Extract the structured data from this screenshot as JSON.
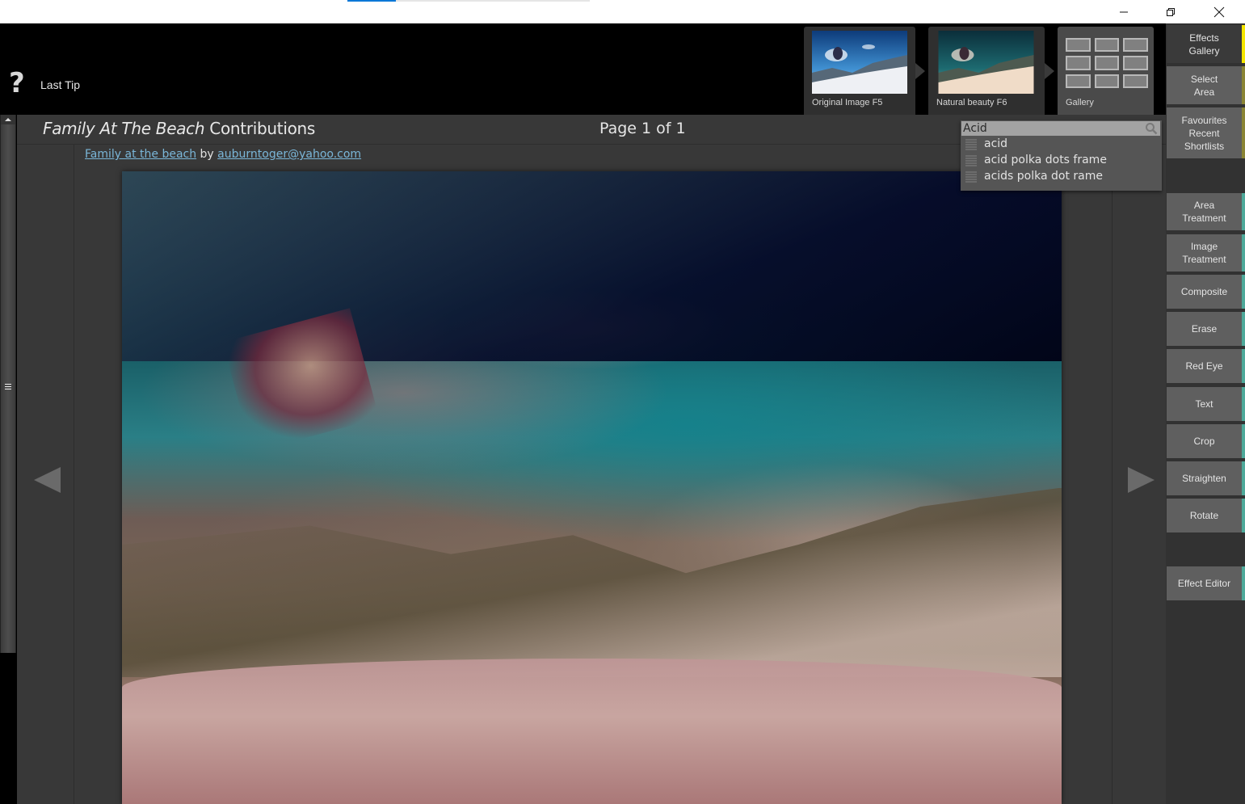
{
  "window": {
    "progress_fraction": 0.2,
    "controls": {
      "minimize": "minimize",
      "restore": "restore",
      "close": "close"
    }
  },
  "header": {
    "tip_icon": "?",
    "tip_label": "Last Tip",
    "thumbnails": [
      {
        "label": "Original Image F5"
      },
      {
        "label": "Natural beauty F6"
      },
      {
        "label": "Gallery"
      }
    ]
  },
  "sidebar": {
    "items": [
      {
        "lines": [
          "Effects",
          "Gallery"
        ]
      },
      {
        "lines": [
          "Select",
          "Area"
        ]
      },
      {
        "lines": [
          "Favourites",
          "Recent",
          "Shortlists"
        ]
      },
      {
        "lines": [
          "Area",
          "Treatment"
        ]
      },
      {
        "lines": [
          "Image",
          "Treatment"
        ]
      },
      {
        "lines": [
          "Composite"
        ]
      },
      {
        "lines": [
          "Erase"
        ]
      },
      {
        "lines": [
          "Red Eye"
        ]
      },
      {
        "lines": [
          "Text"
        ]
      },
      {
        "lines": [
          "Crop"
        ]
      },
      {
        "lines": [
          "Straighten"
        ]
      },
      {
        "lines": [
          "Rotate"
        ]
      },
      {
        "lines": [
          "Effect Editor"
        ]
      }
    ]
  },
  "main": {
    "title_italic": "Family At The Beach",
    "title_rest": " Contributions",
    "page_count": "Page 1 of 1",
    "byline": {
      "link_title": "Family at the beach",
      "by": " by ",
      "link_author": "auburntoger@yahoo.com"
    }
  },
  "search": {
    "value": "Acid",
    "suggestions": [
      "acid",
      "acid polka dots frame",
      "acids polka dot rame"
    ]
  },
  "colors": {
    "accent_yellow": "#f5e600",
    "accent_olive": "#8a8434",
    "accent_teal": "#4ea99a",
    "link": "#7ab6d8"
  }
}
